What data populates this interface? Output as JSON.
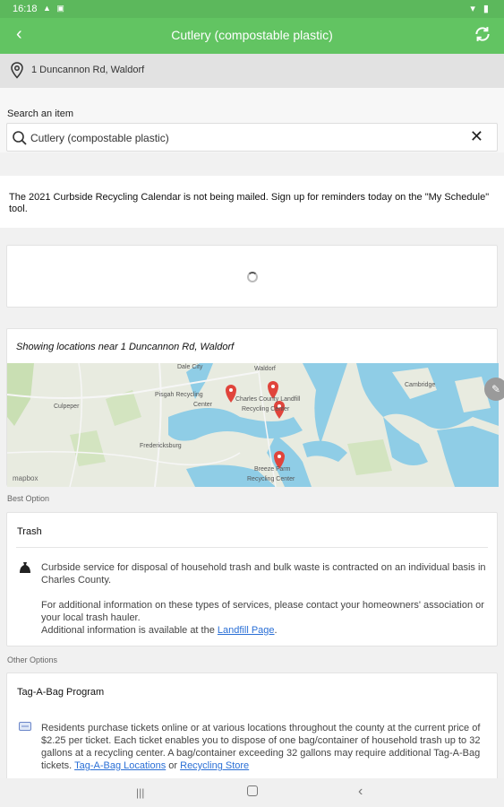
{
  "status_bar": {
    "time": "16:18"
  },
  "app_bar": {
    "title": "Cutlery (compostable plastic)"
  },
  "address": {
    "text": "1 Duncannon Rd, Waldorf"
  },
  "search": {
    "label": "Search an item",
    "value": "Cutlery (compostable plastic)"
  },
  "notice": {
    "text": "The 2021 Curbside Recycling Calendar is not being mailed. Sign up for reminders today on the \"My Schedule\" tool."
  },
  "map": {
    "caption": "Showing locations near 1 Duncannon Rd, Waldorf",
    "places": [
      "Dale City",
      "Waldorf",
      "Pisgah Recycling Center",
      "Charles County Landfill Recycling Center",
      "Culpeper",
      "Fredericksburg",
      "Breeze Farm Recycling Center",
      "Cambridge"
    ],
    "attribution": "mapbox"
  },
  "best_option": {
    "section_label": "Best Option",
    "title": "Trash",
    "para1": "Curbside service for disposal of household trash and bulk waste is contracted on an individual basis in Charles County.",
    "para2": "For additional information on these types of services, please contact your homeowners' association or your local trash hauler.",
    "para3_prefix": "Additional information is available at the ",
    "para3_link": "Landfill Page",
    "para3_suffix": "."
  },
  "other_options": {
    "section_label": "Other Options",
    "title": "Tag-A-Bag Program",
    "body": "Residents purchase tickets online or at various locations throughout the county at the current price of $2.25 per ticket. Each ticket enables you to dispose of one bag/container of household trash up to 32 gallons at a recycling center. A bag/container exceeding 32 gallons may require additional Tag-A-Bag tickets. ",
    "link1": "Tag-A-Bag Locations",
    "or_text": " or ",
    "link2": "Recycling Store"
  },
  "colors": {
    "app_bar": "#62c462",
    "status_bar": "#5cb85c",
    "link": "#2a6fd6",
    "pin": "#e0443b",
    "water": "#8fcde6"
  }
}
